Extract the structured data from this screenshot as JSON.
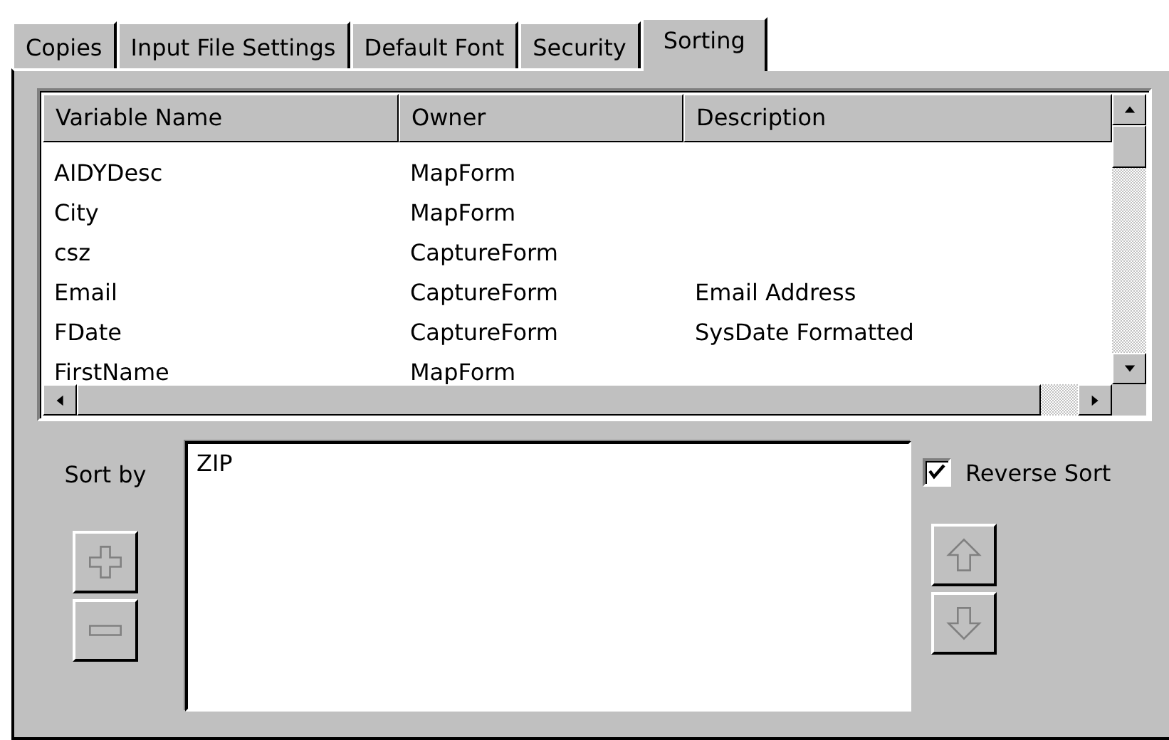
{
  "tabs": [
    {
      "label": "Copies",
      "selected": false
    },
    {
      "label": "Input File Settings",
      "selected": false
    },
    {
      "label": "Default Font",
      "selected": false
    },
    {
      "label": "Security",
      "selected": false
    },
    {
      "label": "Sorting",
      "selected": true
    }
  ],
  "variables": {
    "columns": [
      "Variable Name",
      "Owner",
      "Description"
    ],
    "rows": [
      [
        "AIDYDesc",
        "MapForm",
        ""
      ],
      [
        "City",
        "MapForm",
        ""
      ],
      [
        "csz",
        "CaptureForm",
        ""
      ],
      [
        "Email",
        "CaptureForm",
        "Email Address"
      ],
      [
        "FDate",
        "CaptureForm",
        "SysDate Formatted"
      ],
      [
        "FirstName",
        "MapForm",
        ""
      ]
    ]
  },
  "sort_by": {
    "label": "Sort by",
    "items": [
      "ZIP"
    ]
  },
  "reverse_sort": {
    "label": "Reverse Sort",
    "checked": true
  },
  "buttons": [
    {
      "kind": "add",
      "disabled": true
    },
    {
      "kind": "remove",
      "disabled": true
    },
    {
      "kind": "up",
      "disabled": true
    },
    {
      "kind": "down",
      "disabled": true
    }
  ]
}
